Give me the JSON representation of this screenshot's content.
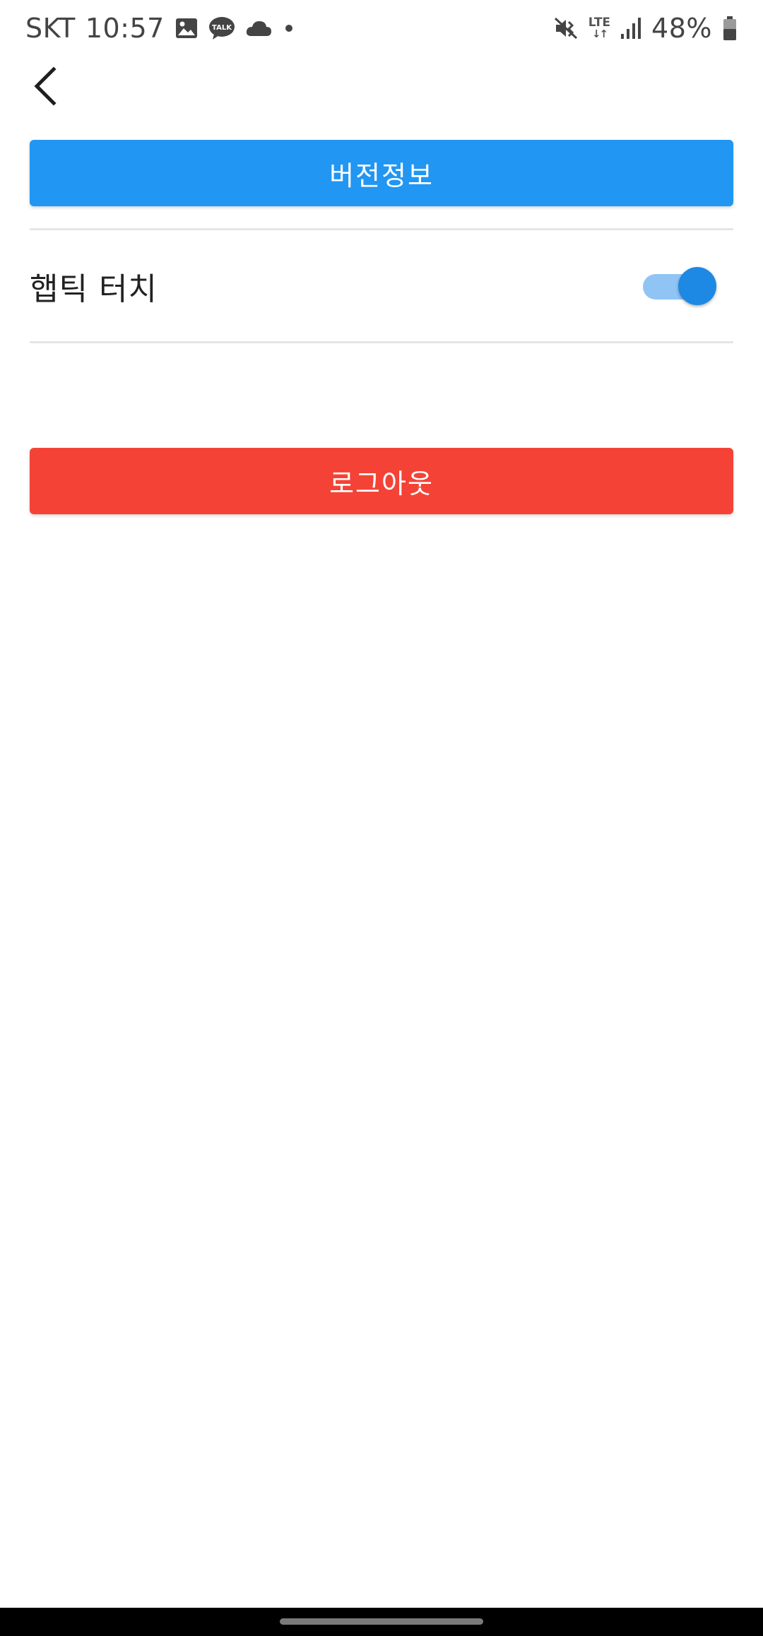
{
  "status_bar": {
    "carrier": "SKT",
    "time": "10:57",
    "network": "LTE",
    "network_arrows": "↓↑",
    "battery_percent": "48%",
    "notification_icons": [
      "gallery-icon",
      "kakaotalk-icon",
      "cloud-icon",
      "dot-icon"
    ],
    "talk_badge": "TALK",
    "system_icons": [
      "mute-vibrate-icon",
      "lte-icon",
      "signal-icon",
      "battery-icon"
    ]
  },
  "header": {
    "back_icon": "chevron-left-icon"
  },
  "settings": {
    "version_button_label": "버전정보",
    "haptic_label": "햅틱 터치",
    "haptic_enabled": true,
    "logout_button_label": "로그아웃"
  },
  "colors": {
    "version_button": "#2196f3",
    "logout_button": "#f44336",
    "toggle_thumb": "#1e88e5",
    "toggle_track": "#90c4f5",
    "nav_bar": "#000000"
  }
}
